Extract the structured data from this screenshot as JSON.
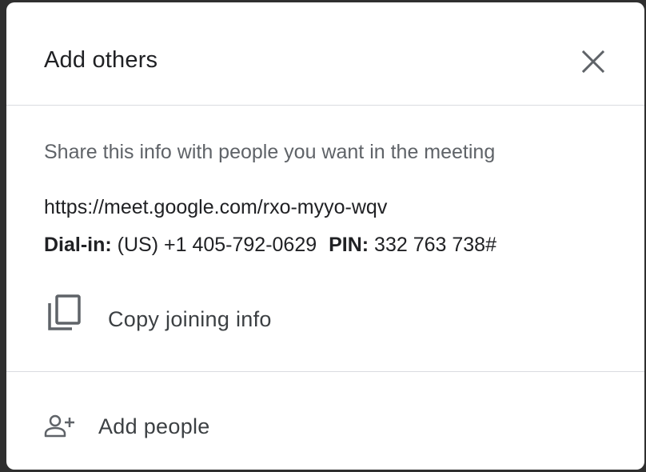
{
  "dialog": {
    "title": "Add others",
    "close_icon": "close-icon"
  },
  "share": {
    "instruction": "Share this info with people you want in the meeting",
    "meeting_link": "https://meet.google.com/rxo-myyo-wqv",
    "dialin_label": "Dial-in:",
    "dialin_number": "(US) +1 405-792-0629",
    "pin_label": "PIN:",
    "pin_value": "332 763 738#"
  },
  "actions": {
    "copy_icon": "copy-icon",
    "copy_label": "Copy joining info",
    "add_icon": "person-add-icon",
    "add_label": "Add people"
  },
  "colors": {
    "title": "#202124",
    "secondary_text": "#5f6368",
    "icon": "#5f6368",
    "divider": "#dadce0"
  }
}
